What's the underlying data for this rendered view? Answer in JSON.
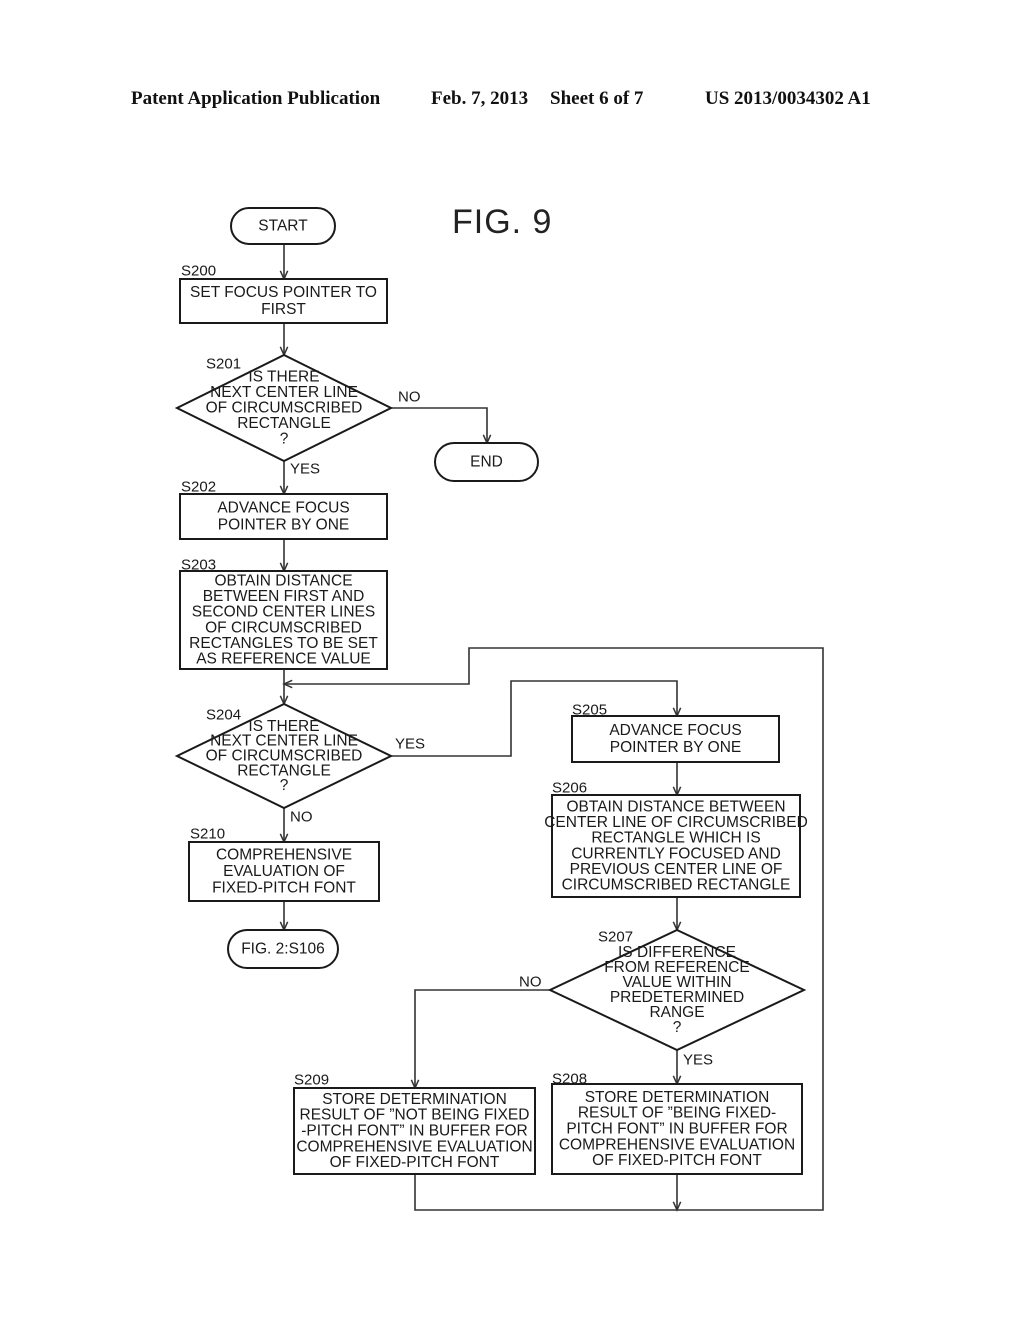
{
  "header": {
    "publication_type": "Patent Application Publication",
    "date": "Feb. 7, 2013",
    "sheet": "Sheet 6 of 7",
    "publication_number": "US 2013/0034302 A1"
  },
  "figure": {
    "title": "FIG. 9"
  },
  "flowchart": {
    "nodes": {
      "start": {
        "type": "terminal",
        "lines": [
          "START"
        ]
      },
      "end": {
        "type": "terminal",
        "lines": [
          "END"
        ]
      },
      "s200": {
        "type": "process",
        "step": "S200",
        "lines": [
          "SET FOCUS POINTER TO",
          "FIRST"
        ]
      },
      "s201": {
        "type": "decision",
        "step": "S201",
        "lines": [
          "IS THERE",
          "NEXT CENTER LINE",
          "OF CIRCUMSCRIBED",
          "RECTANGLE",
          "?"
        ]
      },
      "s202": {
        "type": "process",
        "step": "S202",
        "lines": [
          "ADVANCE FOCUS",
          "POINTER BY ONE"
        ]
      },
      "s203": {
        "type": "process",
        "step": "S203",
        "lines": [
          "OBTAIN DISTANCE",
          "BETWEEN FIRST AND",
          "SECOND CENTER LINES",
          "OF CIRCUMSCRIBED",
          "RECTANGLES TO BE SET",
          "AS REFERENCE VALUE"
        ]
      },
      "s204": {
        "type": "decision",
        "step": "S204",
        "lines": [
          "IS THERE",
          "NEXT CENTER LINE",
          "OF CIRCUMSCRIBED",
          "RECTANGLE",
          "?"
        ]
      },
      "s205": {
        "type": "process",
        "step": "S205",
        "lines": [
          "ADVANCE FOCUS",
          "POINTER BY ONE"
        ]
      },
      "s206": {
        "type": "process",
        "step": "S206",
        "lines": [
          "OBTAIN DISTANCE BETWEEN",
          "CENTER LINE OF CIRCUMSCRIBED",
          "RECTANGLE WHICH IS",
          "CURRENTLY FOCUSED AND",
          "PREVIOUS CENTER LINE OF",
          "CIRCUMSCRIBED RECTANGLE"
        ]
      },
      "s207": {
        "type": "decision",
        "step": "S207",
        "lines": [
          "IS DIFFERENCE",
          "FROM REFERENCE",
          "VALUE WITHIN",
          "PREDETERMINED",
          "RANGE",
          "?"
        ]
      },
      "s208": {
        "type": "process",
        "step": "S208",
        "lines": [
          "STORE DETERMINATION",
          "RESULT OF ”BEING FIXED-",
          "PITCH FONT” IN BUFFER FOR",
          "COMPREHENSIVE EVALUATION",
          "OF FIXED-PITCH FONT"
        ]
      },
      "s209": {
        "type": "process",
        "step": "S209",
        "lines": [
          "STORE DETERMINATION",
          "RESULT OF ”NOT BEING FIXED",
          "-PITCH FONT” IN BUFFER FOR",
          "COMPREHENSIVE EVALUATION",
          "OF FIXED-PITCH FONT"
        ]
      },
      "s210": {
        "type": "process",
        "step": "S210",
        "lines": [
          "COMPREHENSIVE",
          "EVALUATION OF",
          "FIXED-PITCH FONT"
        ]
      },
      "ref": {
        "type": "terminal",
        "lines": [
          "FIG. 2:S106"
        ]
      }
    },
    "edges": [
      {
        "from": "start",
        "to": "s200",
        "label": ""
      },
      {
        "from": "s200",
        "to": "s201",
        "label": ""
      },
      {
        "from": "s201",
        "to": "end",
        "label": "NO"
      },
      {
        "from": "s201",
        "to": "s202",
        "label": "YES"
      },
      {
        "from": "s202",
        "to": "s203",
        "label": ""
      },
      {
        "from": "s203",
        "to": "s204",
        "label": ""
      },
      {
        "from": "s204",
        "to": "s205",
        "label": "YES"
      },
      {
        "from": "s204",
        "to": "s210",
        "label": "NO"
      },
      {
        "from": "s205",
        "to": "s206",
        "label": ""
      },
      {
        "from": "s206",
        "to": "s207",
        "label": ""
      },
      {
        "from": "s207",
        "to": "s208",
        "label": "YES"
      },
      {
        "from": "s207",
        "to": "s209",
        "label": "NO"
      },
      {
        "from": "s208",
        "to": "s204",
        "label": ""
      },
      {
        "from": "s209",
        "to": "s204",
        "label": ""
      },
      {
        "from": "s210",
        "to": "ref",
        "label": ""
      }
    ],
    "branch_labels": {
      "s201_no": "NO",
      "s201_yes": "YES",
      "s204_yes": "YES",
      "s204_no": "NO",
      "s207_no": "NO",
      "s207_yes": "YES"
    }
  }
}
